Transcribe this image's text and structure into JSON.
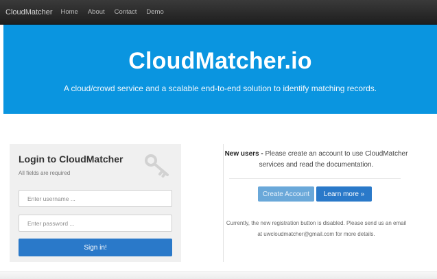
{
  "navbar": {
    "brand": "CloudMatcher",
    "links": [
      "Home",
      "About",
      "Contact",
      "Demo"
    ]
  },
  "hero": {
    "title": "CloudMatcher.io",
    "subtitle": "A cloud/crowd service and a scalable end-to-end solution to identify matching records."
  },
  "login": {
    "title": "Login to CloudMatcher",
    "note": "All fields are required",
    "username_placeholder": "Enter username ...",
    "password_placeholder": "Enter password ...",
    "signin_label": "Sign in!",
    "icon": "key-icon"
  },
  "info": {
    "new_users_label": "New users -",
    "new_users_text": " Please create an account to use CloudMatcher services and read the documentation.",
    "create_account_label": "Create Account",
    "learn_more_label": "Learn more »",
    "notice": "Currently, the new registration button is disabled. Please send us an email at uwcloudmatcher@gmail.com for more details."
  },
  "colors": {
    "hero_bg": "#0a95e0",
    "primary_button": "#2a79c9",
    "disabled_button": "#6aa8d9",
    "navbar_bg": "#2a2a2a"
  }
}
